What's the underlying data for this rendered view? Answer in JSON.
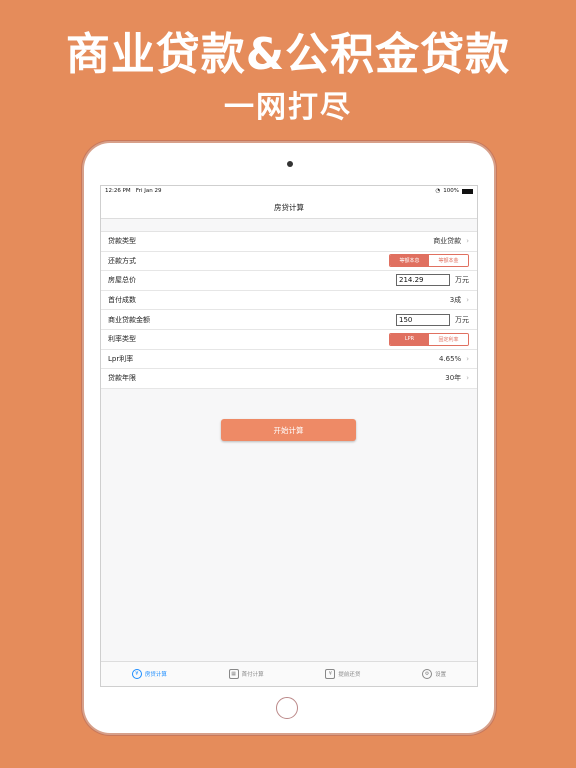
{
  "promo": {
    "headline": "商业贷款&公积金贷款",
    "subline": "一网打尽"
  },
  "status_bar": {
    "time": "12:26 PM",
    "date": "Fri Jan 29",
    "battery": "100%"
  },
  "nav": {
    "title": "房贷计算"
  },
  "rows": {
    "loan_type": {
      "label": "贷款类型",
      "value": "商业贷款"
    },
    "repay_method": {
      "label": "还款方式",
      "options": [
        "等额本息",
        "等额本金"
      ],
      "selected": "等额本息"
    },
    "house_price": {
      "label": "房屋总价",
      "value": "214.29",
      "unit": "万元"
    },
    "down_payment": {
      "label": "首付成数",
      "value": "3成"
    },
    "loan_amount": {
      "label": "商业贷款金额",
      "value": "150",
      "unit": "万元"
    },
    "rate_type": {
      "label": "利率类型",
      "options": [
        "LPR",
        "固定利率"
      ],
      "selected": "LPR"
    },
    "lpr_rate": {
      "label": "Lpr利率",
      "value": "4.65%"
    },
    "loan_years": {
      "label": "贷款年限",
      "value": "30年"
    }
  },
  "calc_button": {
    "label": "开始计算"
  },
  "tabs": [
    {
      "label": "房贷计算",
      "icon": "yen-circle-icon"
    },
    {
      "label": "首付计算",
      "icon": "calculator-icon"
    },
    {
      "label": "提前还贷",
      "icon": "document-yen-icon"
    },
    {
      "label": "设置",
      "icon": "gear-icon"
    }
  ],
  "colors": {
    "background": "#E58C5B",
    "accent": "#E07060",
    "button": "#EE8A66",
    "active_tab": "#1A8CFF"
  }
}
